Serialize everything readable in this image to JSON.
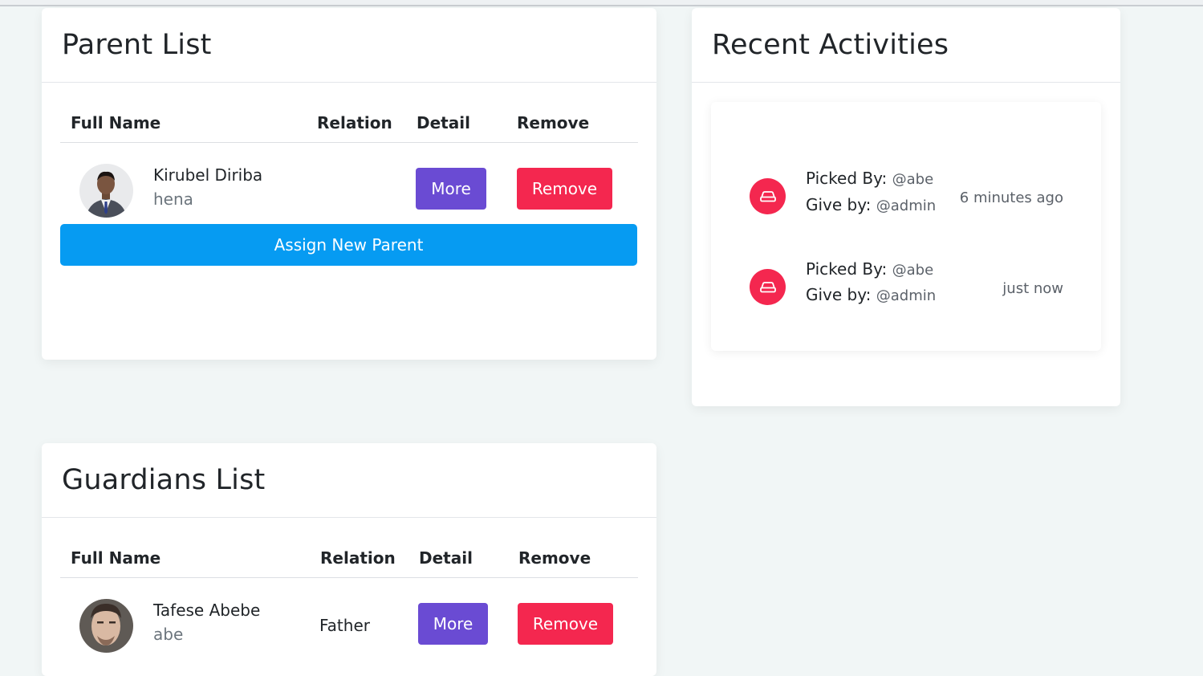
{
  "parent_list": {
    "title": "Parent List",
    "columns": [
      "Full Name",
      "Relation",
      "Detail",
      "Remove"
    ],
    "rows": [
      {
        "name": "Kirubel Diriba",
        "sub": "hena",
        "relation": "",
        "more_label": "More",
        "remove_label": "Remove"
      }
    ],
    "assign_label": "Assign New Parent"
  },
  "recent_activities": {
    "title": "Recent Activities",
    "items": [
      {
        "picked_label": "Picked By:",
        "picked_by": "@abe",
        "give_label": "Give by:",
        "give_by": "@admin",
        "time": "6 minutes ago"
      },
      {
        "picked_label": "Picked By:",
        "picked_by": "@abe",
        "give_label": "Give by:",
        "give_by": "@admin",
        "time": "just now"
      }
    ]
  },
  "guardians_list": {
    "title": "Guardians List",
    "columns": [
      "Full Name",
      "Relation",
      "Detail",
      "Remove"
    ],
    "rows": [
      {
        "name": "Tafese Abebe",
        "sub": "abe",
        "relation": "Father",
        "more_label": "More",
        "remove_label": "Remove"
      }
    ]
  },
  "colors": {
    "accent_purple": "#6a4bd3",
    "danger_red": "#f4274f",
    "primary_blue": "#069bf2",
    "page_bg": "#f1f6f6"
  },
  "icons": {
    "activity": "car-icon"
  }
}
